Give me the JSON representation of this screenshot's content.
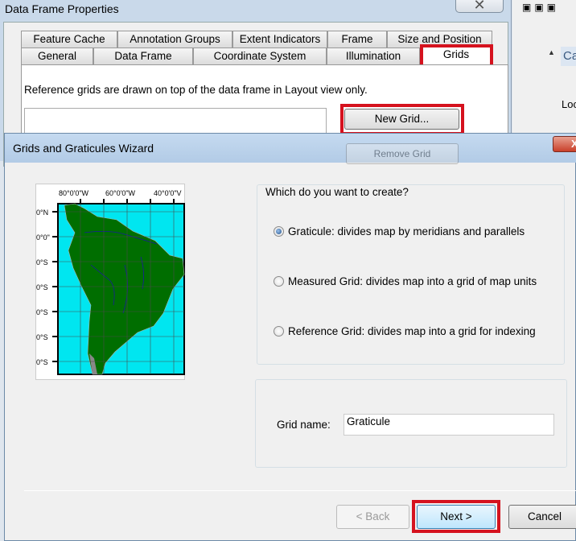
{
  "data_frame_properties": {
    "title": "Data Frame Properties",
    "tabs_row1": [
      "Feature Cache",
      "Annotation Groups",
      "Extent Indicators",
      "Frame",
      "Size and Position"
    ],
    "tabs_row2": [
      "General",
      "Data Frame",
      "Coordinate System",
      "Illumination",
      "Grids"
    ],
    "active_tab": "Grids",
    "description": "Reference grids are drawn on top of the data frame in Layout view only.",
    "new_grid_button": "New Grid...",
    "remove_grid_button": "Remove Grid"
  },
  "background_app": {
    "panel_label_1": "Ca",
    "panel_label_2": "Loc"
  },
  "wizard": {
    "title": "Grids and Graticules Wizard",
    "map_preview": {
      "top_labels": [
        "80°0'0\"W",
        "60°0'0\"W",
        "40°0'0\"V"
      ],
      "left_labels": [
        "0°N",
        "0°0\"",
        "0°S",
        "0°S",
        "0°S",
        "0°S",
        "0°S"
      ],
      "colors": {
        "ocean": "#00e6f0",
        "land": "#006e00",
        "rivers": "#1a1aa0",
        "borders": "#b0b0b0",
        "grid": "#4a4a4a"
      }
    },
    "question": "Which do you want to create?",
    "options": [
      {
        "label": "Graticule: divides map by meridians and parallels",
        "selected": true
      },
      {
        "label": "Measured Grid: divides map into a grid of map units",
        "selected": false
      },
      {
        "label": "Reference Grid: divides map into a grid for indexing",
        "selected": false
      }
    ],
    "grid_name_label": "Grid name:",
    "grid_name_value": "Graticule",
    "back_button": "< Back",
    "next_button": "Next >",
    "cancel_button": "Cancel"
  },
  "highlight_color": "#d5121e"
}
